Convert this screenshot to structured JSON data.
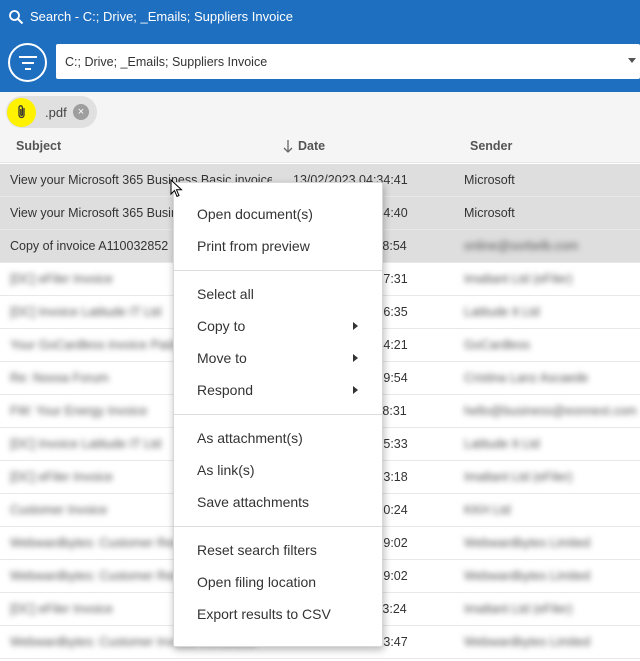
{
  "window": {
    "title": "Search - C:; Drive; _Emails; Suppliers Invoice"
  },
  "toolbar": {
    "location_value": "C:; Drive; _Emails; Suppliers Invoice"
  },
  "filter_chip": {
    "label": ".pdf",
    "close": "×"
  },
  "columns": {
    "subject": "Subject",
    "date": "Date",
    "sender": "Sender"
  },
  "rows": [
    {
      "subject": "View your Microsoft 365 Business Basic invoice",
      "date": "13/02/2023 04:34:41",
      "sender": "Microsoft"
    },
    {
      "subject": "View your Microsoft 365 Business Basic invoice",
      "date": "13/01/2023 04:34:40",
      "sender": "Microsoft"
    },
    {
      "subject": "Copy of invoice A110032852",
      "date": "11/01/2023 09:28:54",
      "sender": "online@sorbelb.com"
    },
    {
      "subject": "[DC] eFiler Invoice",
      "date": "10/01/2023 12:17:31",
      "sender": "Imaltant Ltd (eFiler)"
    },
    {
      "subject": "[DC] Invoice Latitude IT Ltd",
      "date": "09/01/2023 10:16:35",
      "sender": "Latitude It Ltd"
    },
    {
      "subject": "Your GoCardless invoice Paid",
      "date": "06/01/2023 08:24:21",
      "sender": "GoCardless"
    },
    {
      "subject": "Re: Noosa Forum",
      "date": "05/01/2023 16:39:54",
      "sender": "Cristina Lanz Ascaede"
    },
    {
      "subject": "FW: Your Energy Invoice",
      "date": "04/01/2023 11:48:31",
      "sender": "hello@business@eonnext.com"
    },
    {
      "subject": "[DC] Invoice Latitude IT Ltd",
      "date": "03/01/2023 09:25:33",
      "sender": "Latitude It Ltd"
    },
    {
      "subject": "[DC] eFiler Invoice",
      "date": "02/01/2023 14:23:18",
      "sender": "Imaltant Ltd (eFiler)"
    },
    {
      "subject": "Customer Invoice",
      "date": "30/12/2022 10:00:24",
      "sender": "KKH Ltd"
    },
    {
      "subject": "Webwardbytes: Customer Receipt",
      "date": "29/12/2022 16:09:02",
      "sender": "Webwardbytes Limited"
    },
    {
      "subject": "Webwardbytes: Customer Receipt",
      "date": "29/12/2022 16:09:02",
      "sender": "Webwardbytes Limited"
    },
    {
      "subject": "[DC] eFiler Invoice",
      "date": "28/12/2022 11:13:24",
      "sender": "Imaltant Ltd (eFiler)"
    },
    {
      "subject": "Webwardbytes: Customer Invoice INV10103",
      "date": "23/12/2022 22:23:47",
      "sender": "Webwardbytes Limited"
    }
  ],
  "context_menu": {
    "open_documents": "Open document(s)",
    "print_preview": "Print from preview",
    "select_all": "Select all",
    "copy_to": "Copy to",
    "move_to": "Move to",
    "respond": "Respond",
    "as_attachments": "As attachment(s)",
    "as_links": "As link(s)",
    "save_attachments": "Save attachments",
    "reset_filters": "Reset search filters",
    "open_filing_location": "Open filing location",
    "export_csv": "Export results to CSV"
  },
  "colors": {
    "accent": "#1f6fc0",
    "highlight": "#fff200",
    "selected_row": "#dedede"
  },
  "icons": [
    "search-icon",
    "filter-icon",
    "dropdown-caret-icon",
    "paperclip-icon",
    "close-icon",
    "sort-down-arrow-icon",
    "submenu-arrow-icon",
    "cursor-icon"
  ]
}
